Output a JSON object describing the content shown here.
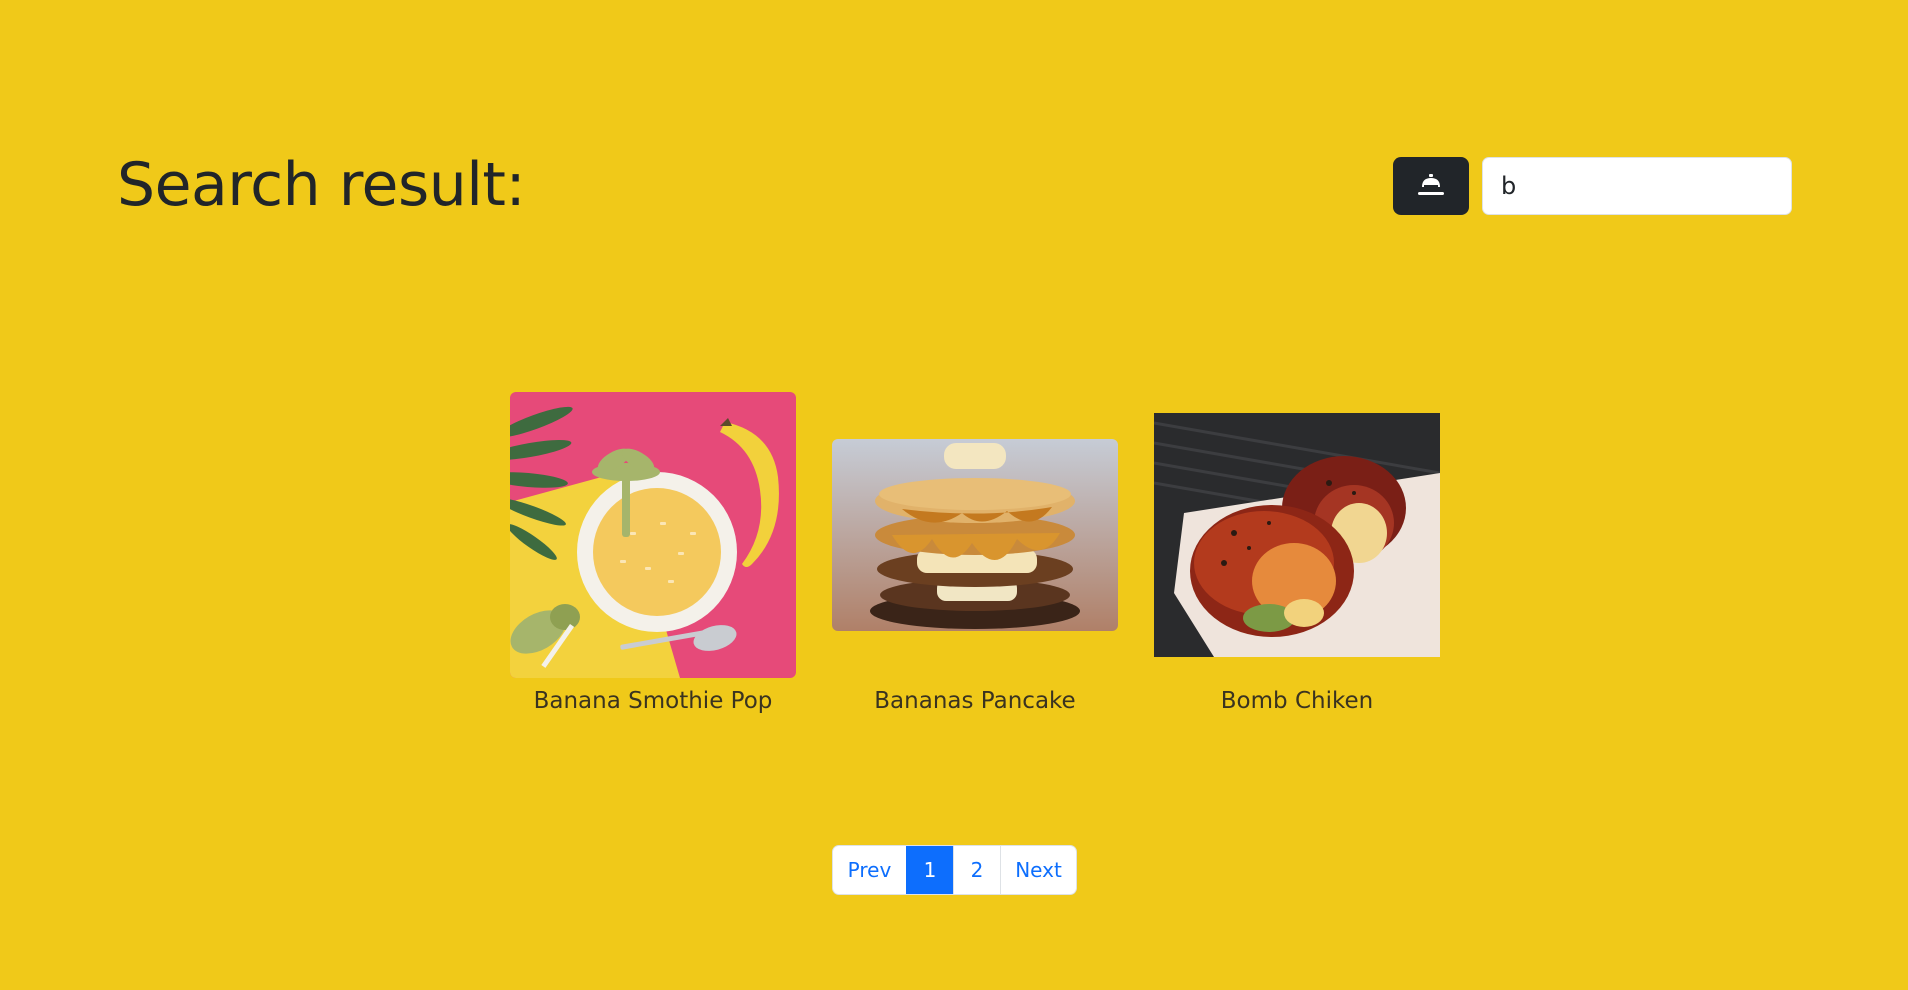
{
  "page_title": "Search result:",
  "search": {
    "value": "b",
    "button_icon": "cook-icon"
  },
  "results": [
    {
      "name": "Banana Smothie Pop",
      "image": "banana-smoothie-photo"
    },
    {
      "name": "Bananas Pancake",
      "image": "banana-pancake-photo"
    },
    {
      "name": "Bomb Chiken",
      "image": "bacon-wrapped-chicken-photo"
    }
  ],
  "pagination": {
    "prev": "Prev",
    "pages": [
      "1",
      "2"
    ],
    "current": "1",
    "next": "Next"
  },
  "colors": {
    "background": "#f0c919",
    "dark": "#212529",
    "link": "#0d6efd",
    "active_page": "#0d6efd"
  }
}
